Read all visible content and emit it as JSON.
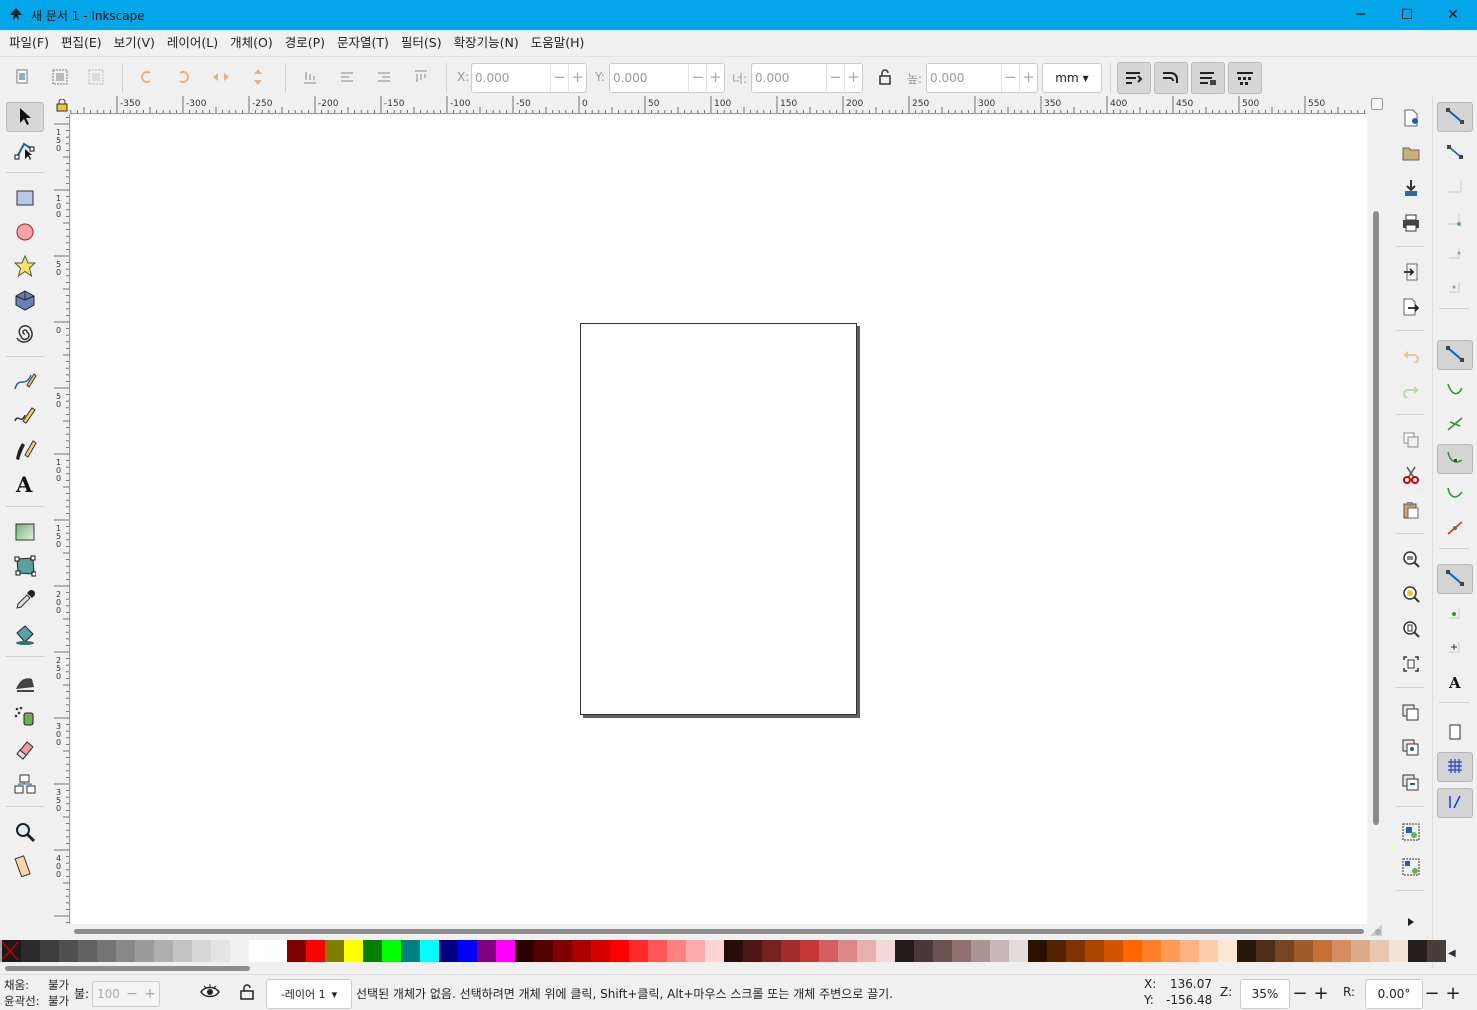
{
  "window": {
    "title": "새 문서 1 - Inkscape",
    "minimize": "─",
    "maximize": "☐",
    "close": "✕"
  },
  "menu": [
    "파일(F)",
    "편집(E)",
    "보기(V)",
    "레이어(L)",
    "개체(O)",
    "경로(P)",
    "문자열(T)",
    "필터(S)",
    "확장기능(N)",
    "도움말(H)"
  ],
  "toolctrl": {
    "x_label": "X:",
    "x_value": "0.000",
    "y_label": "Y:",
    "y_value": "0.000",
    "w_label": "너:",
    "w_value": "0.000",
    "h_label": "높:",
    "h_value": "0.000",
    "minus": "−",
    "plus": "+",
    "unit": "mm"
  },
  "ruler": {
    "top_labels": [
      "-350",
      "-300",
      "-250",
      "-200",
      "-150",
      "-100",
      "-50",
      "0",
      "50",
      "100",
      "150",
      "200",
      "250",
      "300",
      "350",
      "400",
      "450",
      "500",
      "550"
    ],
    "left_labels": [
      "150",
      "100",
      "50",
      "0",
      "50",
      "100",
      "150",
      "200",
      "250",
      "300",
      "350",
      "400"
    ]
  },
  "status": {
    "fill_label": "채움:",
    "fill_value": "불가",
    "stroke_label": "윤곽선:",
    "stroke_value": "불가",
    "opacity_label": "불:",
    "opacity_value": "100",
    "layer": "-레이어 1",
    "message": "선택된 개체가 없음. 선택하려면 개체 위에 클릭, Shift+클릭, Alt+마우스 스크롤 또는 개체 주변으로 끌기.",
    "x_label": "X:",
    "x_value": "136.07",
    "y_label": "Y:",
    "y_value": "-156.48",
    "zoom_label": "Z:",
    "zoom_value": "35%",
    "rotate_label": "R:",
    "rotate_value": "0.00°",
    "minus": "−",
    "plus": "+"
  },
  "palette": [
    "#1a1a1a",
    "#2b2b2b",
    "#3d3d3d",
    "#4f4f4f",
    "#626262",
    "#757575",
    "#888888",
    "#9b9b9b",
    "#afafaf",
    "#c3c3c3",
    "#d7d7d7",
    "#e4e4e4",
    "#f0f0f0",
    "#ffffff",
    "#fefefe",
    "#800000",
    "#ff0000",
    "#808000",
    "#ffff00",
    "#008000",
    "#00ff00",
    "#008080",
    "#00ffff",
    "#000080",
    "#0000ff",
    "#800080",
    "#ff00ff",
    "#2b0000",
    "#550000",
    "#800000",
    "#aa0000",
    "#d40000",
    "#ff0000",
    "#ff2a2a",
    "#ff5555",
    "#ff8080",
    "#ffaaaa",
    "#ffd5d5",
    "#280b0b",
    "#501616",
    "#782121",
    "#a02c2c",
    "#c83737",
    "#d35f5f",
    "#de8787",
    "#e9afaf",
    "#f4d7d7",
    "#241c1c",
    "#483737",
    "#6c5353",
    "#916f6f",
    "#ac9393",
    "#c8b7b7",
    "#e3dbdb",
    "#2b1100",
    "#552200",
    "#803300",
    "#aa4400",
    "#d45500",
    "#ff6600",
    "#ff7f2a",
    "#ff9955",
    "#ffb380",
    "#ffccaa",
    "#ffe6d5",
    "#28170b",
    "#502d16",
    "#784421",
    "#a05a2c",
    "#c87137",
    "#d38d5f",
    "#deaa87",
    "#e9c6af",
    "#f4e3d7",
    "#241f1c",
    "#483e37"
  ],
  "colors": {
    "titlebar": "#01a5e8",
    "canvas": "#ffffff",
    "page_border": "#333333",
    "page_shadow": "#606060"
  }
}
